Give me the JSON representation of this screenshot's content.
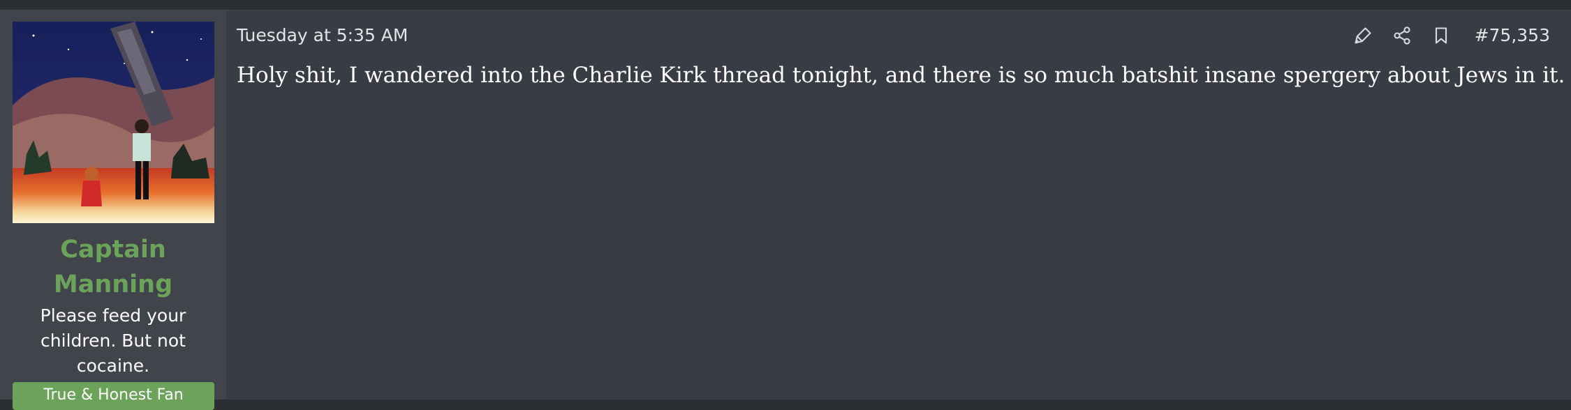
{
  "post": {
    "user": {
      "name": "Captain Manning",
      "title": "Please feed your children. But not cocaine.",
      "banner": "True & Honest Fan"
    },
    "timestamp": "Tuesday at 5:35 AM",
    "post_number": "#75,353",
    "message": "Holy shit, I wandered into the Charlie Kirk thread tonight, and there is so much batshit insane spergery about Jews in it."
  },
  "icons": {
    "highlight": "highlighter-icon",
    "share": "share-icon",
    "bookmark": "bookmark-icon"
  },
  "colors": {
    "username": "#6ba35a",
    "banner": "#6ba35a",
    "post_background": "#393c44",
    "user_column_background": "#41444b"
  }
}
